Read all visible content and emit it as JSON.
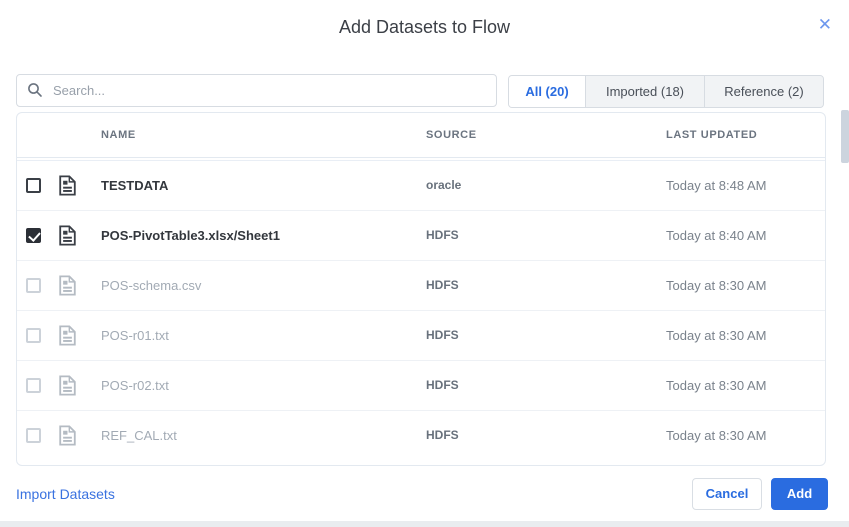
{
  "dialog": {
    "title": "Add Datasets to Flow",
    "close_glyph": "✕"
  },
  "search": {
    "placeholder": "Search...",
    "icon": "magnifier"
  },
  "tabs": [
    {
      "label": "All (20)",
      "active": true
    },
    {
      "label": "Imported (18)",
      "active": false
    },
    {
      "label": "Reference (2)",
      "active": false
    }
  ],
  "table": {
    "columns": {
      "name": "NAME",
      "source": "SOURCE",
      "last_updated": "LAST UPDATED"
    },
    "rows": [
      {
        "name": "TESTDATA",
        "source": "oracle",
        "last_updated": "Today at 8:48 AM",
        "checked": false,
        "dimmed": false
      },
      {
        "name": "POS-PivotTable3.xlsx/Sheet1",
        "source": "HDFS",
        "last_updated": "Today at 8:40 AM",
        "checked": true,
        "dimmed": false
      },
      {
        "name": "POS-schema.csv",
        "source": "HDFS",
        "last_updated": "Today at 8:30 AM",
        "checked": false,
        "dimmed": true
      },
      {
        "name": "POS-r01.txt",
        "source": "HDFS",
        "last_updated": "Today at 8:30 AM",
        "checked": false,
        "dimmed": true
      },
      {
        "name": "POS-r02.txt",
        "source": "HDFS",
        "last_updated": "Today at 8:30 AM",
        "checked": false,
        "dimmed": true
      },
      {
        "name": "REF_CAL.txt",
        "source": "HDFS",
        "last_updated": "Today at 8:30 AM",
        "checked": false,
        "dimmed": true
      }
    ]
  },
  "footer": {
    "import_link": "Import Datasets",
    "cancel_label": "Cancel",
    "add_label": "Add"
  },
  "colors": {
    "accent_blue": "#2a6ce0",
    "close_blue": "#6d97ee",
    "checked_box": "#2b2f36",
    "table_border": "#e3e9f0",
    "dimmed_text": "#a2aab4"
  }
}
